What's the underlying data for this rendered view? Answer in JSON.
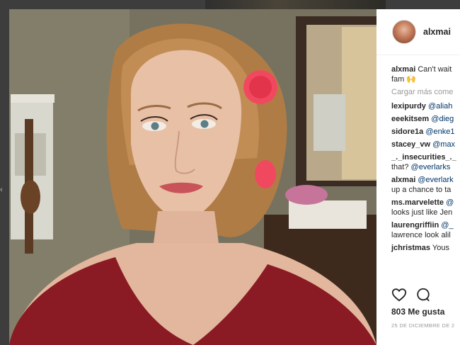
{
  "post": {
    "username": "alxmai",
    "likes_text": "803 Me gusta",
    "date_text": "25 DE DICIEMBRE DE 2"
  },
  "caption": {
    "user": "alxmai",
    "text": "Can't wait",
    "line2": "fam 🙌"
  },
  "load_more": "Cargar más come",
  "comments": [
    {
      "user": "lexipurdy",
      "mention": "@aliah",
      "rest": "",
      "line2": ""
    },
    {
      "user": "eeekitsem",
      "mention": "@dieg",
      "rest": "",
      "line2": ""
    },
    {
      "user": "sidore1a",
      "mention": "@enke1",
      "rest": "",
      "line2": ""
    },
    {
      "user": "stacey_vw",
      "mention": "@max",
      "rest": "",
      "line2": ""
    },
    {
      "user": "_._insecurities_._",
      "mention": "",
      "rest": "",
      "line2_pre": "that?",
      "line2_mention": "@everlarks",
      "line2": ""
    },
    {
      "user": "alxmai",
      "mention": "@everlark",
      "rest": "",
      "line2": "up a chance to ta"
    },
    {
      "user": "ms.marvelette",
      "mention": "@",
      "rest": "",
      "line2": "looks just like Jen"
    },
    {
      "user": "laurengriffiin",
      "mention": "@_",
      "rest": "",
      "line2": "lawrence look alil"
    },
    {
      "user": "jchristmas",
      "mention": "",
      "rest": "Yous",
      "line2": ""
    }
  ],
  "icons": {
    "like": "heart-icon",
    "comment": "comment-icon"
  },
  "colors": {
    "username": "#262626",
    "mention": "#003569",
    "muted": "#999999",
    "panel_bg": "#ffffff",
    "backdrop": "#3d3d3d"
  }
}
